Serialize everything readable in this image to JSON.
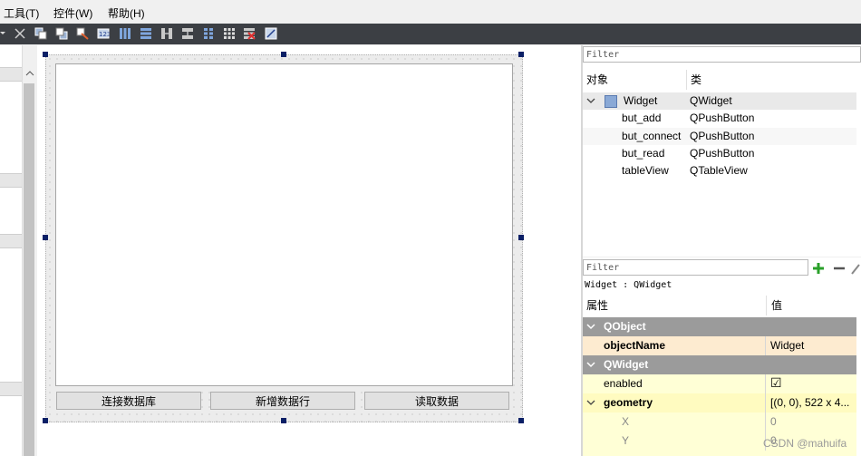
{
  "menubar": {
    "items": [
      "工具(T)",
      "控件(W)",
      "帮助(H)"
    ]
  },
  "toolbar": {
    "icons": [
      "close-icon",
      "bring-front-icon",
      "send-back-icon",
      "edit-buddies-icon",
      "edit-taborder-icon",
      "layout-horizontal-icon",
      "layout-vertical-icon",
      "splitter-horizontal-icon",
      "splitter-vertical-icon",
      "layout-form-icon",
      "layout-grid-icon",
      "break-layout-icon",
      "adjust-size-icon"
    ]
  },
  "form": {
    "buttons": [
      "连接数据库",
      "新增数据行",
      "读取数据"
    ]
  },
  "object_inspector": {
    "filter_placeholder": "Filter",
    "col_object": "对象",
    "col_class": "类",
    "rows": [
      {
        "name": "Widget",
        "cls": "QWidget"
      },
      {
        "name": "but_add",
        "cls": "QPushButton"
      },
      {
        "name": "but_connect",
        "cls": "QPushButton"
      },
      {
        "name": "but_read",
        "cls": "QPushButton"
      },
      {
        "name": "tableView",
        "cls": "QTableView"
      }
    ]
  },
  "property_editor": {
    "filter_placeholder": "Filter",
    "context": "Widget : QWidget",
    "col_property": "属性",
    "col_value": "值",
    "rows": [
      {
        "name": "QObject",
        "value": "",
        "type": "section"
      },
      {
        "name": "objectName",
        "value": "Widget",
        "type": "bold"
      },
      {
        "name": "QWidget",
        "value": "",
        "type": "section"
      },
      {
        "name": "enabled",
        "value": "☑",
        "type": "normal"
      },
      {
        "name": "geometry",
        "value": "[(0, 0), 522 x 4...",
        "type": "bold-expand"
      },
      {
        "name": "X",
        "value": "0",
        "type": "sub"
      },
      {
        "name": "Y",
        "value": "0",
        "type": "sub"
      }
    ]
  },
  "watermark": "CSDN @mahuifa",
  "colors": {
    "toolbar_bg": "#3c3f44",
    "section_bg": "#9b9b9b",
    "selection_handle": "#0a1f66",
    "prop_highlight": "#fdebd0"
  }
}
